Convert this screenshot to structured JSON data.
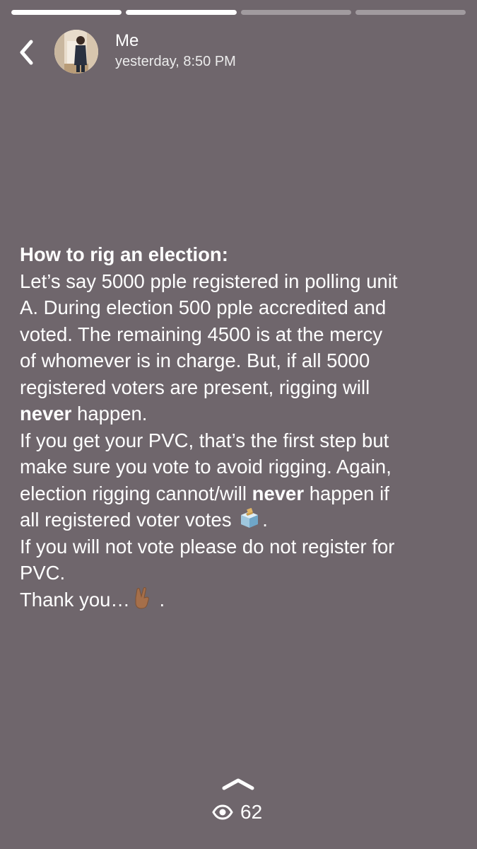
{
  "progress": {
    "segments": [
      {
        "fill": 1.0
      },
      {
        "fill": 1.0
      },
      {
        "fill": 0.0
      },
      {
        "fill": 0.0
      }
    ]
  },
  "header": {
    "name": "Me",
    "time": "yesterday, 8:50 PM"
  },
  "icons": {
    "back": "chevron-left-icon",
    "avatar": "profile-photo",
    "ballot": "ballot-box-emoji",
    "peace": "victory-hand-emoji",
    "swipe": "chevron-up-icon",
    "eye": "eye-icon"
  },
  "post": {
    "l1": "How to rig an election:",
    "l2": "Let’s say 5000 pple registered in polling unit",
    "l3": "A. During election 500 pple accredited and",
    "l4": "voted. The remaining 4500 is at the mercy",
    "l5": "of whomever is in charge. But, if all 5000",
    "l6": "registered voters are present, rigging will",
    "l7_bold": "never",
    "l7_rest": " happen.",
    "l8": "If you get your PVC, that’s the first step but",
    "l9": "make sure you vote to avoid rigging. Again,",
    "l10_a": "election rigging cannot/will ",
    "l10_bold": "never",
    "l10_b": " happen if",
    "l11_a": "all registered voter votes ",
    "l11_b": ".",
    "l12": "If you will not vote please do not register for",
    "l13": "PVC.",
    "l14_a": "Thank you…",
    "l14_b": " ."
  },
  "footer": {
    "views": "62"
  }
}
